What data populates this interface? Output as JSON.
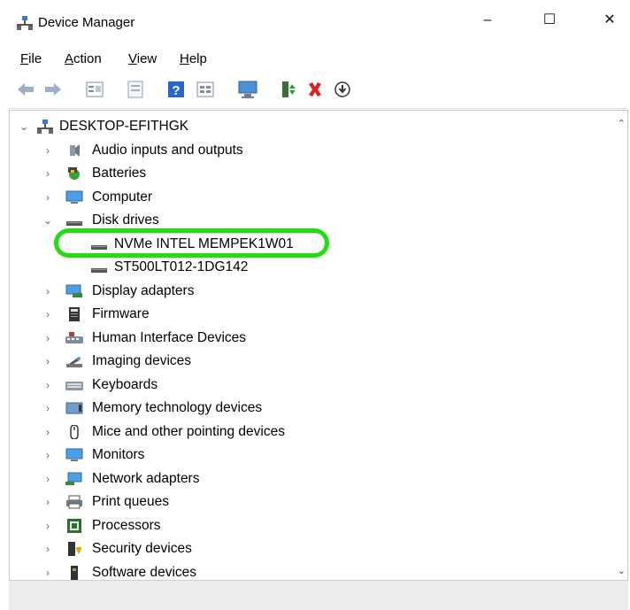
{
  "window": {
    "title": "Device Manager",
    "minimize": "–",
    "maximize": "☐",
    "close": "✕"
  },
  "menu": [
    {
      "label": "File",
      "ul": "F",
      "rest": "ile"
    },
    {
      "label": "Action",
      "ul": "A",
      "rest": "ction"
    },
    {
      "label": "View",
      "ul": "V",
      "rest": "iew"
    },
    {
      "label": "Help",
      "ul": "H",
      "rest": "elp"
    }
  ],
  "toolbar": {
    "icons": [
      "back-arrow-icon",
      "forward-arrow-icon",
      "properties-icon",
      "show-hidden-icon",
      "help-icon",
      "view-icon",
      "scan-hardware-icon",
      "enable-device-icon",
      "uninstall-icon",
      "update-driver-icon"
    ]
  },
  "tree": {
    "root": "DESKTOP-EFITHGK",
    "items": [
      {
        "label": "Audio inputs and outputs",
        "icon": "speaker-icon"
      },
      {
        "label": "Batteries",
        "icon": "battery-icon"
      },
      {
        "label": "Computer",
        "icon": "computer-icon"
      },
      {
        "label": "Disk drives",
        "icon": "disk-icon"
      },
      {
        "label": "NVMe INTEL MEMPEK1W01",
        "icon": "disk-icon"
      },
      {
        "label": "ST500LT012-1DG142",
        "icon": "disk-icon"
      },
      {
        "label": "Display adapters",
        "icon": "display-adapter-icon"
      },
      {
        "label": "Firmware",
        "icon": "firmware-icon"
      },
      {
        "label": "Human Interface Devices",
        "icon": "hid-icon"
      },
      {
        "label": "Imaging devices",
        "icon": "camera-icon"
      },
      {
        "label": "Keyboards",
        "icon": "keyboard-icon"
      },
      {
        "label": "Memory technology devices",
        "icon": "memory-icon"
      },
      {
        "label": "Mice and other pointing devices",
        "icon": "mouse-icon"
      },
      {
        "label": "Monitors",
        "icon": "monitor-icon"
      },
      {
        "label": "Network adapters",
        "icon": "network-icon"
      },
      {
        "label": "Print queues",
        "icon": "printer-icon"
      },
      {
        "label": "Processors",
        "icon": "processor-icon"
      },
      {
        "label": "Security devices",
        "icon": "security-icon"
      },
      {
        "label": "Software devices",
        "icon": "software-icon"
      }
    ]
  },
  "highlight_color": "#22dd11"
}
